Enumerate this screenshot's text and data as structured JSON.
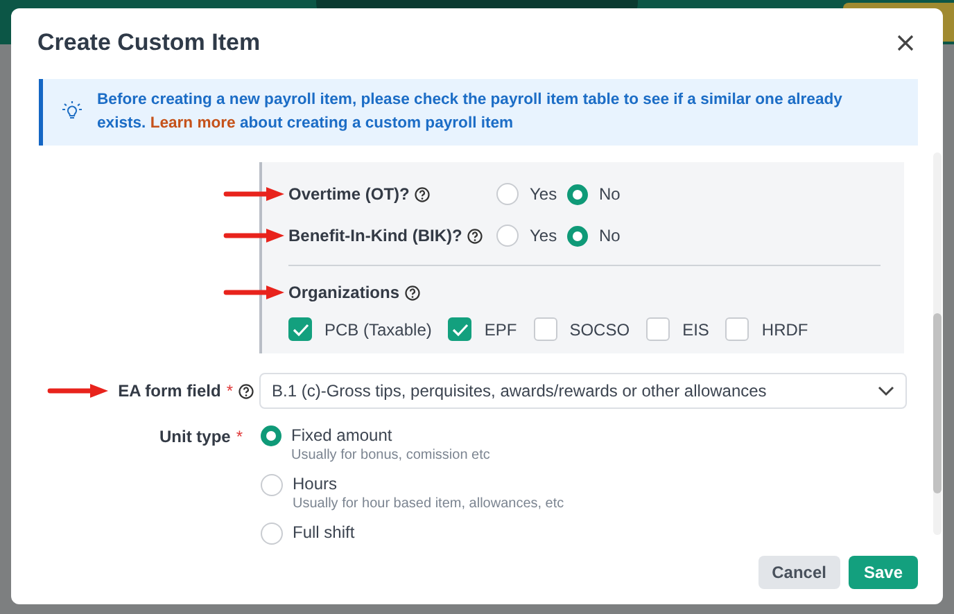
{
  "dialog": {
    "title": "Create Custom Item"
  },
  "notice": {
    "text_before": "Before creating a new payroll item, please check the payroll item table to see if a similar one already exists.",
    "link": "Learn more",
    "text_after": "about creating a custom payroll item"
  },
  "toggles": [
    {
      "label": "Overtime (OT)?",
      "annotated": true,
      "options": [
        {
          "label": "Yes",
          "selected": false
        },
        {
          "label": "No",
          "selected": true
        }
      ]
    },
    {
      "label": "Benefit-In-Kind (BIK)?",
      "annotated": true,
      "options": [
        {
          "label": "Yes",
          "selected": false
        },
        {
          "label": "No",
          "selected": true
        }
      ]
    }
  ],
  "organizations": {
    "label": "Organizations",
    "annotated": true,
    "options": [
      {
        "label": "PCB (Taxable)",
        "checked": true
      },
      {
        "label": "EPF",
        "checked": true
      },
      {
        "label": "SOCSO",
        "checked": false
      },
      {
        "label": "EIS",
        "checked": false
      },
      {
        "label": "HRDF",
        "checked": false
      }
    ]
  },
  "ea_form_field": {
    "label": "EA form field",
    "required_mark": "*",
    "annotated": true,
    "value": "B.1 (c)-Gross tips, perquisites, awards/rewards or other allowances"
  },
  "unit_type": {
    "label": "Unit type",
    "required_mark": "*",
    "options": [
      {
        "label": "Fixed amount",
        "hint": "Usually for bonus, comission etc",
        "selected": true
      },
      {
        "label": "Hours",
        "hint": "Usually for hour based item, allowances, etc",
        "selected": false
      },
      {
        "label": "Full shift",
        "selected": false
      }
    ]
  },
  "buttons": [
    {
      "label": "Cancel",
      "kind": "secondary"
    },
    {
      "label": "Save",
      "kind": "primary"
    }
  ]
}
